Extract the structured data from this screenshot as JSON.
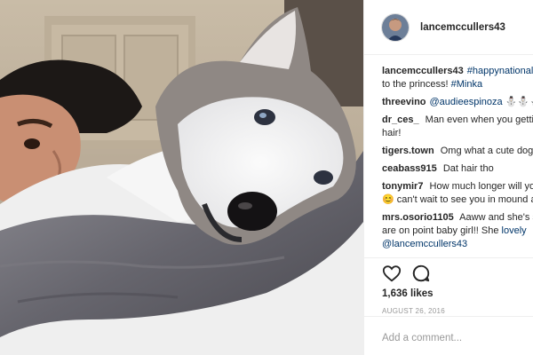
{
  "post": {
    "username": "lancemccullers43",
    "caption_parts": {
      "user": "lancemccullers43",
      "tag": "#happynational",
      "text": "to the princess!",
      "tag2": "#Minka"
    },
    "comments": [
      {
        "user": "threevino",
        "mention": "@audieespinoza",
        "text": "⛄⛄⛄"
      },
      {
        "user": "dr_ces_",
        "text": "Man even when you gettin have cool hair!"
      },
      {
        "user": "tigers.town",
        "text": "Omg what a cute dog"
      },
      {
        "user": "ceabass915",
        "text": "Dat hair tho"
      },
      {
        "user": "tonymir7",
        "text": "How much longer will you the DL? 😊 can't wait to see you in mound again"
      },
      {
        "user": "mrs.osorio1105",
        "text": "Aaww and she's s 😜 You are on point baby girl!! She",
        "tail": "lovely @lancemccullers43"
      }
    ],
    "likes": "1,636 likes",
    "date": "AUGUST 26, 2016",
    "add_comment_placeholder": "Add a comment...",
    "icons": {
      "like": "heart-icon",
      "comment": "comment-bubble-icon"
    },
    "colors": {
      "link": "#003569",
      "text": "#262626",
      "muted": "#999999",
      "border": "#efefef"
    }
  }
}
